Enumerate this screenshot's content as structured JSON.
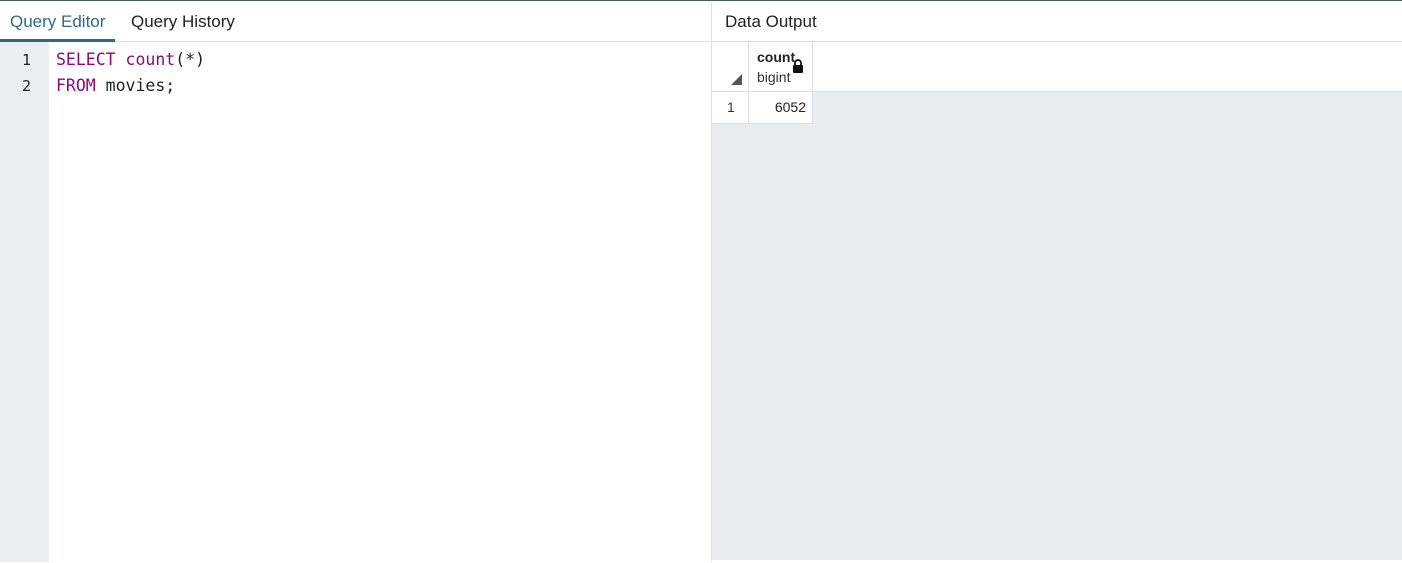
{
  "query_panel": {
    "tabs": [
      {
        "label": "Query Editor",
        "active": true
      },
      {
        "label": "Query History",
        "active": false
      }
    ],
    "editor": {
      "line_numbers": [
        "1",
        "2"
      ],
      "lines": [
        {
          "keyword": "SELECT",
          "function": "count",
          "rest": "(*)"
        },
        {
          "keyword": "FROM",
          "rest": " movies;"
        }
      ]
    }
  },
  "output_panel": {
    "tab_label": "Data Output",
    "columns": [
      {
        "name": "count",
        "type": "bigint",
        "icon": "lock-icon"
      }
    ],
    "rows": [
      {
        "row_number": "1",
        "values": [
          "6052"
        ]
      }
    ]
  },
  "colors": {
    "accent": "#326690",
    "keyword": "#8b0a7d",
    "gutter_bg": "#ebeef3",
    "grid_bg": "#e9ecf0"
  }
}
